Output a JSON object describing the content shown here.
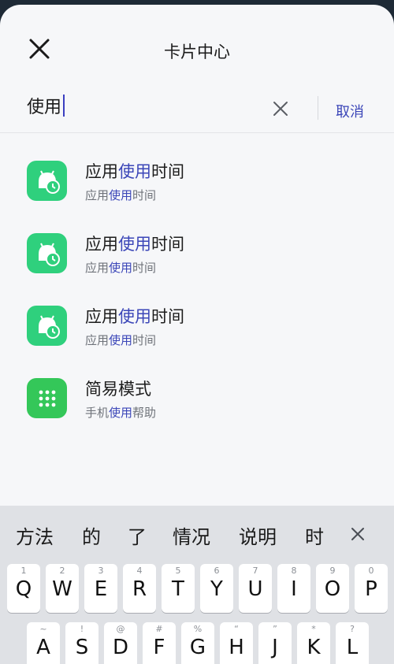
{
  "header": {
    "title": "卡片中心",
    "close_icon": "close-icon"
  },
  "search": {
    "value": "使用",
    "clear_icon": "clear-icon",
    "cancel_label": "取消"
  },
  "results": [
    {
      "title_pre": "应用",
      "title_hl": "使用",
      "title_post": "时间",
      "sub_pre": "应用",
      "sub_hl": "使用",
      "sub_post": "时间",
      "icon": "app-usage-icon",
      "color": "#2fd07d"
    },
    {
      "title_pre": "应用",
      "title_hl": "使用",
      "title_post": "时间",
      "sub_pre": "应用",
      "sub_hl": "使用",
      "sub_post": "时间",
      "icon": "app-usage-icon",
      "color": "#2fd07d"
    },
    {
      "title_pre": "应用",
      "title_hl": "使用",
      "title_post": "时间",
      "sub_pre": "应用",
      "sub_hl": "使用",
      "sub_post": "时间",
      "icon": "app-usage-icon",
      "color": "#2fd07d"
    },
    {
      "title_pre": "简易模式",
      "title_hl": "",
      "title_post": "",
      "sub_pre": "手机",
      "sub_hl": "使用",
      "sub_post": "帮助",
      "icon": "grid-dots-icon",
      "color": "#34c759"
    }
  ],
  "keyboard": {
    "candidates": [
      "方法",
      "的",
      "了",
      "情况",
      "说明",
      "时"
    ],
    "close_icon": "close-icon",
    "row1": [
      {
        "letter": "Q",
        "hint": "1"
      },
      {
        "letter": "W",
        "hint": "2"
      },
      {
        "letter": "E",
        "hint": "3"
      },
      {
        "letter": "R",
        "hint": "4"
      },
      {
        "letter": "T",
        "hint": "5"
      },
      {
        "letter": "Y",
        "hint": "6"
      },
      {
        "letter": "U",
        "hint": "7"
      },
      {
        "letter": "I",
        "hint": "8"
      },
      {
        "letter": "O",
        "hint": "9"
      },
      {
        "letter": "P",
        "hint": "0"
      }
    ],
    "row2": [
      {
        "letter": "A",
        "hint": "~"
      },
      {
        "letter": "S",
        "hint": "!"
      },
      {
        "letter": "D",
        "hint": "@"
      },
      {
        "letter": "F",
        "hint": "#"
      },
      {
        "letter": "G",
        "hint": "%"
      },
      {
        "letter": "H",
        "hint": "“"
      },
      {
        "letter": "J",
        "hint": "”"
      },
      {
        "letter": "K",
        "hint": "*"
      },
      {
        "letter": "L",
        "hint": "?"
      }
    ]
  },
  "colors": {
    "accent": "#3b46b8",
    "caret": "#3b3fc1"
  }
}
